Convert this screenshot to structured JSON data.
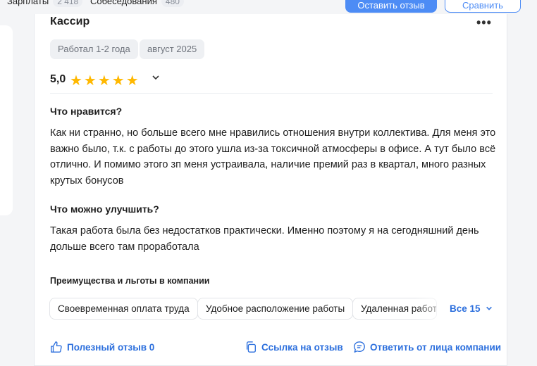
{
  "topbar": {
    "salaries_label": "Зарплаты",
    "salaries_count": "2 418",
    "interviews_label": "Собеседования",
    "interviews_count": "480",
    "leave_review_button": "Оставить отзыв",
    "compare_button": "Сравнить"
  },
  "review": {
    "title": "Кассир",
    "tags": [
      "Работал 1-2 года",
      "август 2025"
    ],
    "rating": "5,0",
    "stars": "★★★★★",
    "likes_heading": "Что нравится?",
    "likes_text": "Как ни странно, но больше всего мне нравились отношения внутри коллектива. Для меня это важно было, т.к. с работы до этого ушла из-за токсичной атмосферы в офисе. А тут было всё отлично. И помимо этого зп меня устраивала, наличие премий раз в квартал, много разных крутых бонусов",
    "improve_heading": "Что можно улучшить?",
    "improve_text": "Такая работа была без недостатков практически. Именно поэтому я на сегодняшний день дольше всего там проработала",
    "benefits_heading": "Преимущества и льготы в компании",
    "benefits": [
      "Своевременная оплата труда",
      "Удобное расположение работы",
      "Удаленная работа"
    ],
    "benefits_all": "Все 15",
    "helpful": "Полезный отзыв 0",
    "link": "Ссылка на отзыв",
    "reply": "Ответить от лица компании"
  },
  "colors": {
    "accent": "#2c6fdd",
    "primary_button": "#4d8cf5",
    "star": "#ffb800"
  }
}
